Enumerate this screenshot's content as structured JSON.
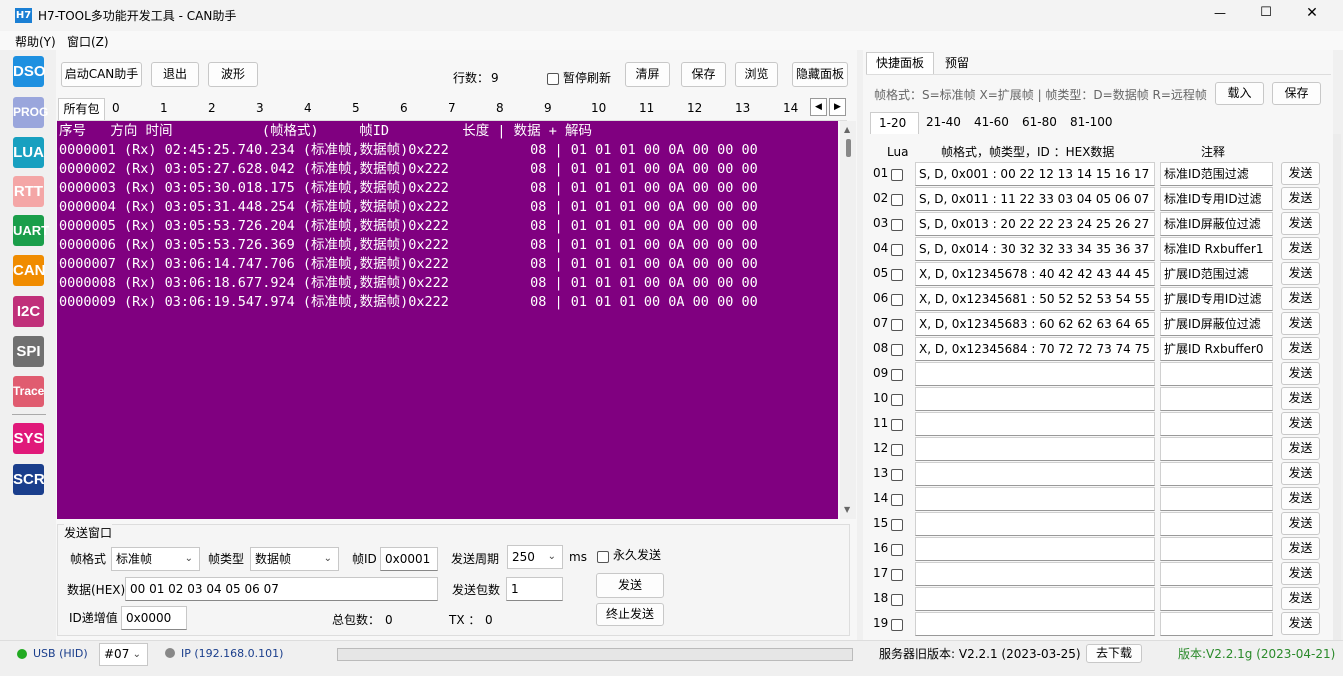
{
  "window": {
    "logo": "H7",
    "title": "H7-TOOL多功能开发工具 - CAN助手",
    "minimize": "—",
    "maximize": "☐",
    "close": "✕"
  },
  "menu": [
    "帮助(Y)",
    "窗口(Z)"
  ],
  "sidebar": [
    {
      "label": "DSO",
      "color": "#1e90e0"
    },
    {
      "label": "PROG",
      "color": "#9aa6dc"
    },
    {
      "label": "LUA",
      "color": "#18a0c0"
    },
    {
      "label": "RTT",
      "color": "#f4a6a6"
    },
    {
      "label": "UART",
      "color": "#1a9e4a"
    },
    {
      "label": "CAN",
      "color": "#f08c00"
    },
    {
      "label": "I2C",
      "color": "#c0307a"
    },
    {
      "label": "SPI",
      "color": "#707070"
    },
    {
      "label": "Trace",
      "color": "#e05c70"
    },
    {
      "label": "SYS",
      "color": "#e0197a"
    },
    {
      "label": "SCR",
      "color": "#1a3e8c"
    }
  ],
  "toolbar": {
    "start": "启动CAN助手",
    "exit": "退出",
    "wave": "波形",
    "rows_label": "行数：",
    "rows_value": "9",
    "pause": "暂停刷新",
    "clear": "清屏",
    "save": "保存",
    "browse": "浏览",
    "hide_panel": "隐藏面板"
  },
  "packet_tabs": [
    "所有包",
    "0",
    "1",
    "2",
    "3",
    "4",
    "5",
    "6",
    "7",
    "8",
    "9",
    "10",
    "11",
    "12",
    "13",
    "14"
  ],
  "log": {
    "header": "序号   方向 时间           (帧格式)     帧ID         长度 | 数据 + 解码",
    "rows": [
      "0000001 (Rx) 02:45:25.740.234 (标准帧,数据帧)0x222          08 | 01 01 01 00 0A 00 00 00",
      "0000002 (Rx) 03:05:27.628.042 (标准帧,数据帧)0x222          08 | 01 01 01 00 0A 00 00 00",
      "0000003 (Rx) 03:05:30.018.175 (标准帧,数据帧)0x222          08 | 01 01 01 00 0A 00 00 00",
      "0000004 (Rx) 03:05:31.448.254 (标准帧,数据帧)0x222          08 | 01 01 01 00 0A 00 00 00",
      "0000005 (Rx) 03:05:53.726.204 (标准帧,数据帧)0x222          08 | 01 01 01 00 0A 00 00 00",
      "0000006 (Rx) 03:05:53.726.369 (标准帧,数据帧)0x222          08 | 01 01 01 00 0A 00 00 00",
      "0000007 (Rx) 03:06:14.747.706 (标准帧,数据帧)0x222          08 | 01 01 01 00 0A 00 00 00",
      "0000008 (Rx) 03:06:18.677.924 (标准帧,数据帧)0x222          08 | 01 01 01 00 0A 00 00 00",
      "0000009 (Rx) 03:06:19.547.974 (标准帧,数据帧)0x222          08 | 01 01 01 00 0A 00 00 00"
    ]
  },
  "send_window": {
    "title": "发送窗口",
    "frame_format_label": "帧格式",
    "frame_format_value": "标准帧",
    "frame_type_label": "帧类型",
    "frame_type_value": "数据帧",
    "id_label": "帧ID",
    "id_value": "0x0001",
    "period_label": "发送周期",
    "period_value": "250",
    "period_unit": "ms",
    "forever": "永久发送",
    "data_label": "数据(HEX)",
    "data_value": "00 01 02 03 04 05 06 07",
    "count_label": "发送包数",
    "count_value": "1",
    "send": "发送",
    "id_inc_label": "ID递增值",
    "id_inc_value": "0x0000",
    "total_label": "总包数：",
    "total_value": "0",
    "tx_label": "TX ：",
    "tx_value": "0",
    "stop": "终止发送"
  },
  "quick_panel": {
    "tabs": [
      "快捷面板",
      "预留"
    ],
    "format_hint": "帧格式：S=标准帧 X=扩展帧 | 帧类型：D=数据帧 R=远程帧",
    "load": "载入",
    "save": "保存",
    "page_tabs": [
      "1-20",
      "21-40",
      "41-60",
      "61-80",
      "81-100"
    ],
    "col_lua": "Lua",
    "col_frame": "帧格式，帧类型，ID ：HEX数据",
    "col_note": "注释",
    "send_label": "发送",
    "rows": [
      {
        "n": "01",
        "hex": "S, D, 0x001 : 00 22 12 13 14 15 16 17",
        "note": "标准ID范围过滤"
      },
      {
        "n": "02",
        "hex": "S, D, 0x011 : 11 22 33 03 04 05 06 07",
        "note": "标准ID专用ID过滤"
      },
      {
        "n": "03",
        "hex": "S, D, 0x013 : 20 22 22 23 24 25 26 27",
        "note": "标准ID屏蔽位过滤"
      },
      {
        "n": "04",
        "hex": "S, D, 0x014 : 30 32 32 33 34 35 36 37",
        "note": "标准ID Rxbuffer1"
      },
      {
        "n": "05",
        "hex": "X, D, 0x12345678 : 40 42 42 43 44 45 46",
        "note": "扩展ID范围过滤"
      },
      {
        "n": "06",
        "hex": "X, D, 0x12345681 : 50 52 52 53 54 55 56",
        "note": "扩展ID专用ID过滤"
      },
      {
        "n": "07",
        "hex": "X, D, 0x12345683 : 60 62 62 63 64 65 66",
        "note": "扩展ID屏蔽位过滤"
      },
      {
        "n": "08",
        "hex": "X, D, 0x12345684 : 70 72 72 73 74 75 76",
        "note": "扩展ID Rxbuffer0"
      },
      {
        "n": "09",
        "hex": "",
        "note": ""
      },
      {
        "n": "10",
        "hex": "",
        "note": ""
      },
      {
        "n": "11",
        "hex": "",
        "note": ""
      },
      {
        "n": "12",
        "hex": "",
        "note": ""
      },
      {
        "n": "13",
        "hex": "",
        "note": ""
      },
      {
        "n": "14",
        "hex": "",
        "note": ""
      },
      {
        "n": "15",
        "hex": "",
        "note": ""
      },
      {
        "n": "16",
        "hex": "",
        "note": ""
      },
      {
        "n": "17",
        "hex": "",
        "note": ""
      },
      {
        "n": "18",
        "hex": "",
        "note": ""
      },
      {
        "n": "19",
        "hex": "",
        "note": ""
      }
    ]
  },
  "status": {
    "usb": "USB (HID)",
    "usb_color": "#22aa22",
    "device": "#07",
    "ip": "IP (192.168.0.101)",
    "ip_color": "#888888",
    "server_version": "服务器旧版本: V2.2.1 (2023-03-25)",
    "download": "去下载",
    "version": "版本:V2.2.1g (2023-04-21)",
    "version_color": "#2a8a2a"
  }
}
